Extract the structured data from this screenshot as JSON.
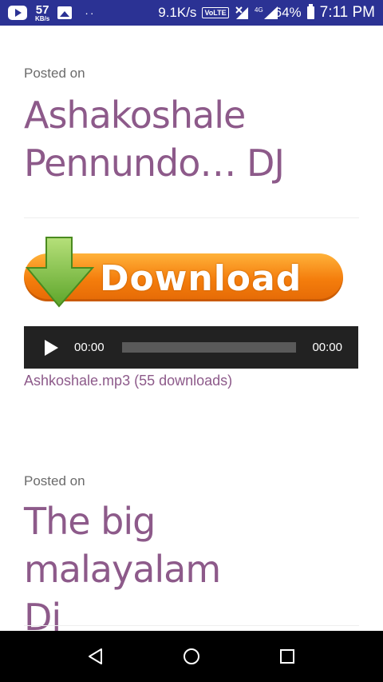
{
  "status_bar": {
    "net_speed_value": "57",
    "net_speed_unit": "KB/s",
    "dots": "··",
    "speed": "9.1K/s",
    "volte": "VoLTE",
    "network": "4G",
    "battery": "64%",
    "time": "7:11 PM"
  },
  "posts": [
    {
      "posted_label": "Posted on",
      "title": [
        "Ashakoshale",
        "Pennundo… DJ"
      ]
    },
    {
      "posted_label": "Posted on",
      "title": [
        "The big malayalam",
        "Dj"
      ]
    }
  ],
  "download": {
    "label": "Download"
  },
  "player": {
    "current_time": "00:00",
    "duration": "00:00",
    "progress": 0
  },
  "file_link": "Ashkoshale.mp3 (55 downloads)",
  "colors": {
    "status_bar": "#2b3294",
    "title": "#8d5a8a",
    "button_orange": "#f47d0c",
    "arrow_green": "#7cc242"
  }
}
